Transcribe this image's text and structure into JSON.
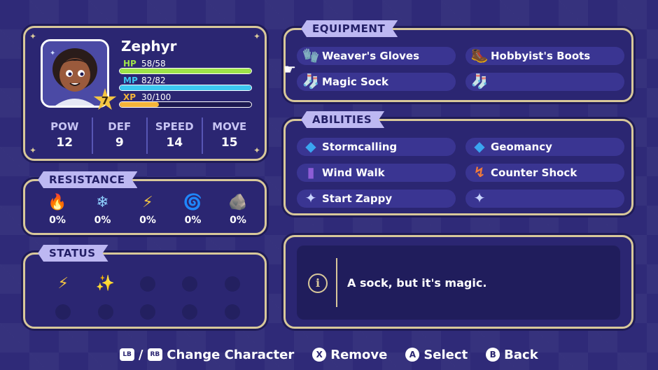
{
  "character": {
    "name": "Zephyr",
    "level": "7",
    "hp": {
      "label": "HP",
      "value": "58/58",
      "fraction": 1.0,
      "color": "#9ee34a"
    },
    "mp": {
      "label": "MP",
      "value": "82/82",
      "fraction": 1.0,
      "color": "#3cc7f0"
    },
    "xp": {
      "label": "XP",
      "value": "30/100",
      "fraction": 0.3,
      "color": "#f4b43a"
    },
    "stats": [
      {
        "label": "POW",
        "value": "12"
      },
      {
        "label": "DEF",
        "value": "9"
      },
      {
        "label": "SPEED",
        "value": "14"
      },
      {
        "label": "MOVE",
        "value": "15"
      }
    ]
  },
  "resistance": {
    "title": "RESISTANCE",
    "items": [
      {
        "icon": "fire-icon",
        "glyph": "🔥",
        "value": "0%"
      },
      {
        "icon": "snowflake-icon",
        "glyph": "❄",
        "value": "0%"
      },
      {
        "icon": "lightning-icon",
        "glyph": "⚡",
        "value": "0%"
      },
      {
        "icon": "swirl-icon",
        "glyph": "🌀",
        "value": "0%"
      },
      {
        "icon": "rock-icon",
        "glyph": "🪨",
        "value": "0%"
      }
    ]
  },
  "status": {
    "title": "STATUS",
    "effects": [
      {
        "icon": "speed-boost-icon",
        "glyph": "⚡"
      },
      {
        "icon": "sparkles-icon",
        "glyph": "✨"
      }
    ]
  },
  "equipment": {
    "title": "EQUIPMENT",
    "items": [
      {
        "icon": "gloves-icon",
        "glyph": "🧤",
        "label": "Weaver's Gloves"
      },
      {
        "icon": "boots-icon",
        "glyph": "🥾",
        "label": "Hobbyist's Boots"
      },
      {
        "icon": "sock-icon",
        "glyph": "🧦",
        "label": "Magic Sock"
      },
      {
        "icon": "sock-slot-icon",
        "glyph": "🧦",
        "label": ""
      }
    ]
  },
  "abilities": {
    "title": "ABILITIES",
    "items": [
      {
        "icon": "stormcalling-icon",
        "glyph": "◆",
        "color": "#3aa5f0",
        "label": "Stormcalling"
      },
      {
        "icon": "geomancy-icon",
        "glyph": "◆",
        "color": "#3aa5f0",
        "label": "Geomancy"
      },
      {
        "icon": "wind-walk-icon",
        "glyph": "▮",
        "color": "#8d5cd6",
        "label": "Wind Walk"
      },
      {
        "icon": "counter-shock-icon",
        "glyph": "↯",
        "color": "#f07a3a",
        "label": "Counter Shock"
      },
      {
        "icon": "sparkle-icon",
        "glyph": "✦",
        "color": "#c9d4ff",
        "label": "Start Zappy"
      },
      {
        "icon": "sparkle-slot-icon",
        "glyph": "✦",
        "color": "#c9d4ff",
        "label": ""
      }
    ]
  },
  "description": {
    "text": "A sock, but it's magic."
  },
  "controls": {
    "lb": "LB",
    "rb": "RB",
    "separator": "/",
    "change_character": "Change Character",
    "x_button": "X",
    "remove": "Remove",
    "a_button": "A",
    "select": "Select",
    "b_button": "B",
    "back": "Back"
  }
}
